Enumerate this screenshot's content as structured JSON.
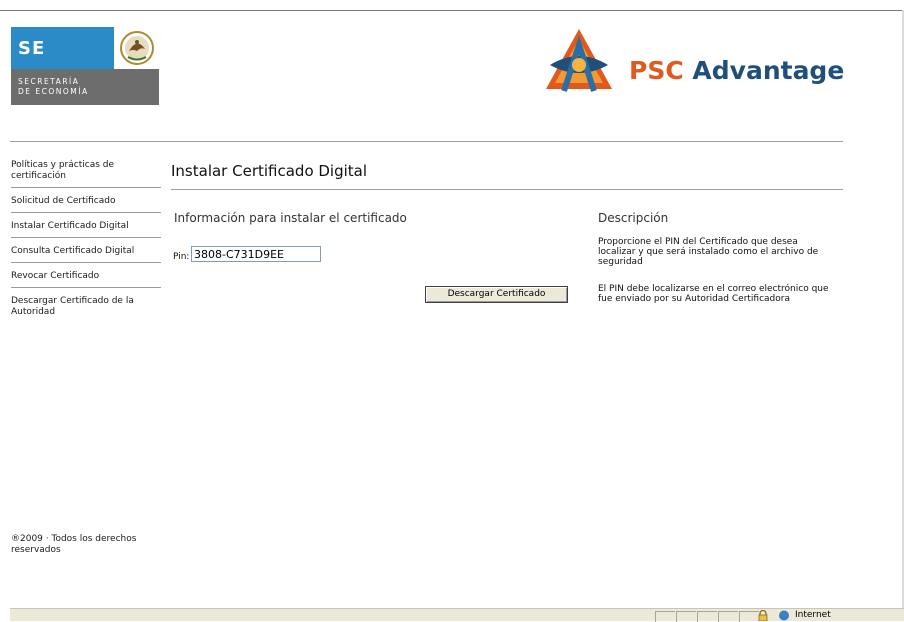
{
  "header": {
    "se_logo": {
      "letters": "SE",
      "line1": "SECRETARÍA",
      "line2": "DE ECONOMÍA"
    },
    "psc_logo": {
      "word1": "PSC",
      "word2": "Advantage"
    }
  },
  "sidebar": {
    "items": [
      {
        "label": "Políticas y prácticas de certificación"
      },
      {
        "label": "Solicitud de Certificado"
      },
      {
        "label": "Instalar Certificado Digital"
      },
      {
        "label": "Consulta Certificado Digital"
      },
      {
        "label": "Revocar Certificado"
      },
      {
        "label": "Descargar Certificado de la Autoridad"
      }
    ],
    "footer": "®2009 · Todos los derechos reservados"
  },
  "main": {
    "title": "Instalar Certificado Digital",
    "section_title": "Información para instalar el certificado",
    "pin_label": "Pin:",
    "pin_value": "3808-C731D9EE",
    "download_button": "Descargar Certificado"
  },
  "description": {
    "title": "Descripción",
    "paragraph1": "Proporcione el PIN del Certificado que desea localizar y que será instalado como el archivo de seguridad",
    "paragraph2": "El PIN debe localizarse en el correo electrónico que fue enviado por su Autoridad Certificadora"
  },
  "statusbar": {
    "zone": "Internet"
  },
  "colors": {
    "se_blue": "#2a8bc6",
    "se_gray": "#6d6d6d",
    "psc_orange": "#e05a1e",
    "psc_navy": "#1f4f7a"
  }
}
